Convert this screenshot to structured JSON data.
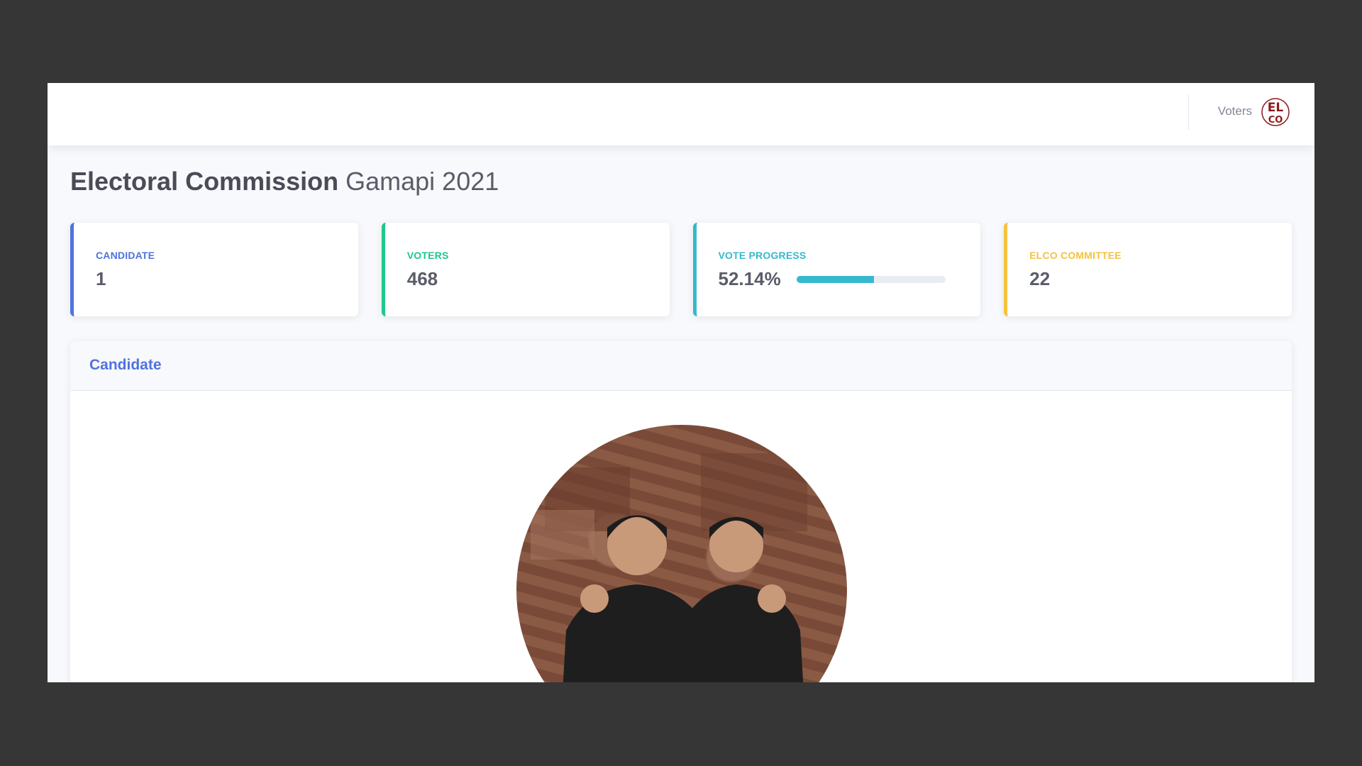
{
  "topbar": {
    "user_name": "Voters",
    "logo_text_top": "EL",
    "logo_text_bottom": "CO",
    "logo_color": "#8b1a1a"
  },
  "page": {
    "title_strong": "Electoral Commission",
    "title_light": "Gamapi 2021"
  },
  "cards": [
    {
      "label": "Candidate",
      "value": "1",
      "color": "#4e73df"
    },
    {
      "label": "Voters",
      "value": "468",
      "color": "#1cc88a"
    },
    {
      "label": "Vote Progress",
      "value": "52.14%",
      "progress": 52.14,
      "color": "#36b9cc"
    },
    {
      "label": "Elco Committee",
      "value": "22",
      "color": "#f6c23e"
    }
  ],
  "panel": {
    "header": "Candidate"
  },
  "candidate": {
    "photo_alt": "candidate-photo"
  }
}
